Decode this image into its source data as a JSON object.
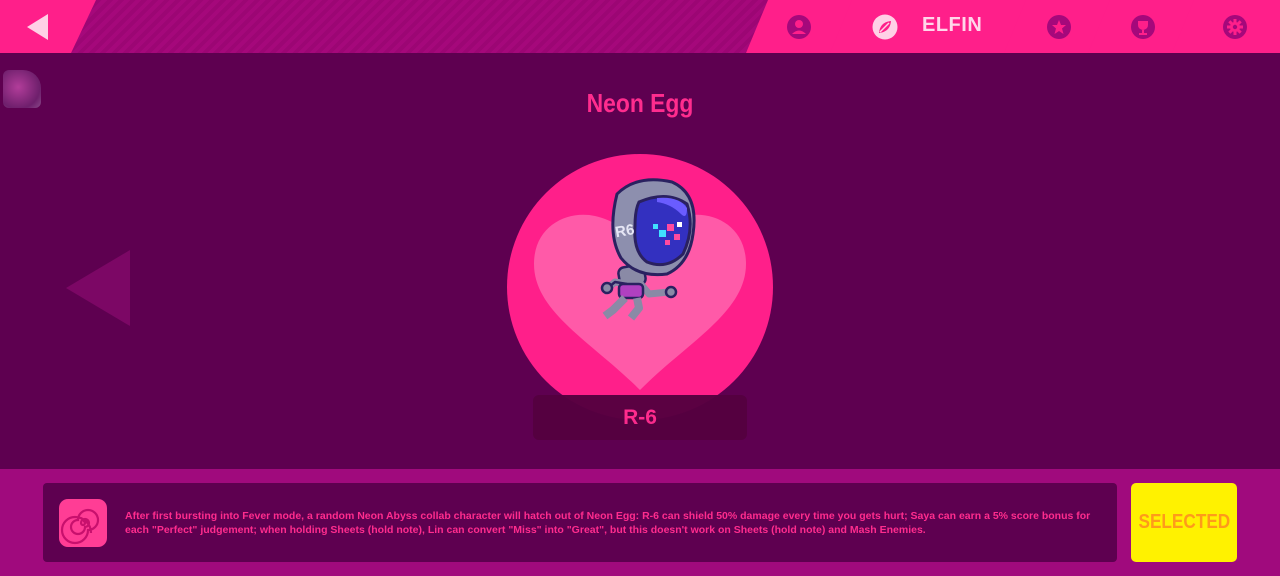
{
  "topbar": {
    "back_icon": "back-arrow-icon",
    "nav": [
      {
        "name": "profile",
        "icon": "user-icon"
      },
      {
        "name": "elfin",
        "icon": "leaf-icon",
        "label": "ELFIN"
      },
      {
        "name": "achievements",
        "icon": "star-icon"
      },
      {
        "name": "trophies",
        "icon": "trophy-icon"
      },
      {
        "name": "settings",
        "icon": "gear-icon"
      }
    ]
  },
  "elfin": {
    "title": "Neon Egg",
    "character_name": "R-6"
  },
  "skill": {
    "icon": "spiral-icon",
    "description": "After first bursting into Fever mode, a random Neon Abyss collab character will hatch out of Neon Egg: R-6 can shield 50% damage every time you gets hurt; Saya can earn a 5% score bonus for each \"Perfect\" judgement; when holding Sheets (hold note), Lin can convert \"Miss\" into \"Great\", but this doesn't work on Sheets (hold note) and Mash Enemies."
  },
  "select_button": {
    "label": "SELECTED"
  },
  "colors": {
    "accent": "#ff1f8a",
    "background": "#5e0050",
    "bottom_bar": "#a00a7d",
    "selected_button": "#fff200",
    "selected_text": "#ff9a1a"
  }
}
